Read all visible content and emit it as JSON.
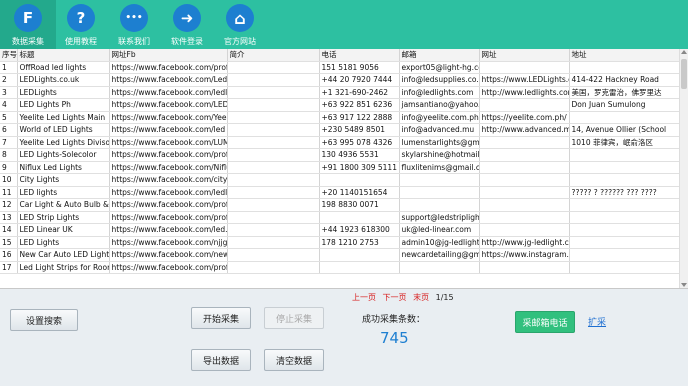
{
  "toolbar": {
    "items": [
      {
        "label": "数据采集",
        "glyph": "F",
        "icon": "f-logo-icon",
        "active": true
      },
      {
        "label": "使用教程",
        "glyph": "?",
        "icon": "help-icon",
        "active": false
      },
      {
        "label": "联系我们",
        "glyph": "•••",
        "icon": "chat-icon",
        "active": false
      },
      {
        "label": "软件登录",
        "glyph": "➜",
        "icon": "login-arrow-icon",
        "active": false
      },
      {
        "label": "官方网站",
        "glyph": "⌂",
        "icon": "home-icon",
        "active": false
      }
    ]
  },
  "table": {
    "headers": [
      "序号",
      "标题",
      "网址Fb",
      "简介",
      "电话",
      "邮箱",
      "网址",
      "地址"
    ],
    "rows": [
      [
        "1",
        "OffRoad led lights",
        "https://www.facebook.com/profi",
        "",
        "151 5181 9056",
        "export05@light-hg.co",
        "",
        ""
      ],
      [
        "2",
        "LEDLights.co.uk",
        "https://www.facebook.com/Led",
        "",
        "+44 20 7920 7444",
        "info@ledsupplies.co.uk",
        "https://www.LEDLights.c",
        "414-422 Hackney Road"
      ],
      [
        "3",
        "LEDLights",
        "https://www.facebook.com/ledl",
        "",
        "+1 321-690-2462",
        "info@ledlights.com",
        "http://www.ledlights.com",
        "美国，罗克雷治，佛罗里达"
      ],
      [
        "4",
        "LED Lights Ph",
        "https://www.facebook.com/LED",
        "",
        "+63 922 851 6236",
        "jamsantiano@yahoo.c",
        "",
        "Don Juan Sumulong"
      ],
      [
        "5",
        "Yeelite Led Lights Main",
        "https://www.facebook.com/Yeel",
        "",
        "+63 917 122 2888",
        "info@yeelite.com.ph",
        "https://yeelite.com.ph/",
        ""
      ],
      [
        "6",
        "World of LED Lights",
        "https://www.facebook.com/led",
        "",
        "+230 5489 8501",
        "info@advanced.mu",
        "http://www.advanced.m",
        "14,  Avenue Ollier (School"
      ],
      [
        "7",
        "Yeelite Led Lights Divisoria",
        "https://www.facebook.com/LUM",
        "",
        "+63 995 078 4326",
        "lumenstarlights@gmail.",
        "",
        "1010 菲律宾，岷俞洛区"
      ],
      [
        "8",
        "LED Lights-Solecolor",
        "https://www.facebook.com/profi",
        "",
        "130 4936 5531",
        "skylarshine@hotmail.co",
        "",
        ""
      ],
      [
        "9",
        "Niflux Led Lights",
        "https://www.facebook.com/Niflu",
        "",
        "+91 1800 309 5111",
        "fluxlitenims@gmail.com",
        "",
        ""
      ],
      [
        "10",
        "City Lights",
        "https://www.facebook.com/cityli",
        "",
        "",
        "",
        "",
        ""
      ],
      [
        "11",
        "LED lights",
        "https://www.facebook.com/ledli",
        "",
        "+20 1140151654",
        "",
        "",
        "????? ? ?????? ??? ????"
      ],
      [
        "12",
        "Car Light & Auto Bulb &",
        "https://www.facebook.com/profi",
        "",
        "198 8830 0071",
        "",
        "",
        ""
      ],
      [
        "13",
        "LED Strip Lights",
        "https://www.facebook.com/profi",
        "",
        "",
        "support@ledstriplights.",
        "",
        ""
      ],
      [
        "14",
        "LED Linear UK",
        "https://www.facebook.com/led.li",
        "",
        "+44 1923 618300",
        "uk@led-linear.com",
        "",
        ""
      ],
      [
        "15",
        "LED Lights",
        "https://www.facebook.com/njjgl",
        "",
        "178 1210 2753",
        "admin10@jg-ledlight.c",
        "http://www.jg-ledlight.co",
        ""
      ],
      [
        "16",
        "New Car Auto LED Lights",
        "https://www.facebook.com/new",
        "",
        "",
        "newcardetailing@gmai",
        "https://www.instagram.c",
        ""
      ],
      [
        "17",
        "Led Light Strips for Room",
        "https://www.facebook.com/profi",
        "",
        "",
        "",
        "",
        ""
      ]
    ]
  },
  "pager": {
    "first": "上一页",
    "next": "下一页",
    "last": "末页",
    "page": "1/15"
  },
  "buttons": {
    "search_settings": "设置搜索",
    "start": "开始采集",
    "stop": "停止采集",
    "export": "导出数据",
    "clear": "清空数据",
    "collect_email_phone": "采邮箱电话",
    "expand": "扩采"
  },
  "stats": {
    "label": "成功采集条数：",
    "count": "745"
  }
}
